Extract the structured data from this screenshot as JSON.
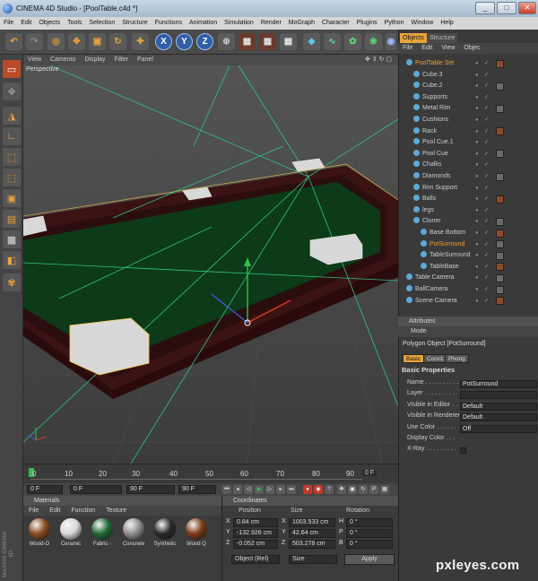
{
  "window": {
    "title": "CINEMA 4D Studio - [PoolTable.c4d *]"
  },
  "menubar": [
    "File",
    "Edit",
    "Objects",
    "Tools",
    "Selection",
    "Structure",
    "Functions",
    "Animation",
    "Simulation",
    "Render",
    "MoGraph",
    "Character",
    "Plugins",
    "Python",
    "Window",
    "Help"
  ],
  "toolbar": {
    "axis_x": "X",
    "axis_y": "Y",
    "axis_z": "Z"
  },
  "viewport": {
    "menu": [
      "View",
      "Cameras",
      "Display",
      "Filter",
      "Panel"
    ],
    "label": "Perspective"
  },
  "timeline": {
    "ticks": [
      "0",
      "10",
      "20",
      "30",
      "40",
      "50",
      "60",
      "70",
      "80",
      "90"
    ],
    "end_label": "0 F",
    "start_field": "0 F",
    "current_field": "0 F",
    "frame_field": "90 F",
    "end_field": "90 F"
  },
  "materials": {
    "header": "Materials",
    "menu": [
      "File",
      "Edit",
      "Function",
      "Texture"
    ],
    "items": [
      {
        "name": "Wood-O",
        "color": "#8a4b1f"
      },
      {
        "name": "Ceramic",
        "color": "#d9d9d9"
      },
      {
        "name": "Fabric -",
        "color": "#1f6a35"
      },
      {
        "name": "Concrete",
        "color": "#8d8d8d"
      },
      {
        "name": "Synthetic",
        "color": "#2a2a2a"
      },
      {
        "name": "Wood Q",
        "color": "#7a3a17"
      }
    ]
  },
  "coordinates": {
    "header": "Coordinates",
    "cols": [
      "Position",
      "Size",
      "Rotation"
    ],
    "rows": [
      {
        "axis": "X",
        "pos": "0.84 cm",
        "size": "1003.533 cm",
        "rlabel": "H",
        "rot": "0 °"
      },
      {
        "axis": "Y",
        "pos": "-132.926 cm",
        "size": "42.64 cm",
        "rlabel": "P",
        "rot": "0 °"
      },
      {
        "axis": "Z",
        "pos": "-0.052 cm",
        "size": "503.278 cm",
        "rlabel": "B",
        "rot": "0 °"
      }
    ],
    "mode": "Object (Rel)",
    "size_mode": "Size",
    "apply": "Apply"
  },
  "objects": {
    "tabs": [
      "Objects",
      "Structure"
    ],
    "menu": [
      "File",
      "Edit",
      "View",
      "Objec"
    ],
    "items": [
      {
        "name": "PoolTable Set",
        "indent": 0,
        "selected": true
      },
      {
        "name": "Cube.3",
        "indent": 1
      },
      {
        "name": "Cube.2",
        "indent": 1
      },
      {
        "name": "Supports",
        "indent": 1
      },
      {
        "name": "Metal Rim",
        "indent": 1
      },
      {
        "name": "Cushions",
        "indent": 1
      },
      {
        "name": "Rack",
        "indent": 1
      },
      {
        "name": "Pool Cue.1",
        "indent": 1
      },
      {
        "name": "Pool Cue",
        "indent": 1
      },
      {
        "name": "Chalks",
        "indent": 1
      },
      {
        "name": "Diamonds",
        "indent": 1
      },
      {
        "name": "Rim Support",
        "indent": 1
      },
      {
        "name": "Balls",
        "indent": 1
      },
      {
        "name": "legs",
        "indent": 1
      },
      {
        "name": "Cloner",
        "indent": 1
      },
      {
        "name": "Base Bottom",
        "indent": 2
      },
      {
        "name": "PotSurround",
        "indent": 2,
        "selected": true
      },
      {
        "name": "TableSurround",
        "indent": 2
      },
      {
        "name": "TableBase",
        "indent": 2
      },
      {
        "name": "Table Camera",
        "indent": 0
      },
      {
        "name": "BallCamera",
        "indent": 0
      },
      {
        "name": "Scene Camera",
        "indent": 0
      }
    ]
  },
  "attributes": {
    "header": "Attributes",
    "mode": "Mode",
    "object_title": "Polygon Object [PotSurround]",
    "tabs": [
      "Basic",
      "Coord.",
      "Phong"
    ],
    "section": "Basic Properties",
    "props": [
      {
        "label": "Name . . . . . . . . . .",
        "value": "PotSurround"
      },
      {
        "label": "Layer . . . . . . . . .",
        "value": ""
      },
      {
        "label": "Visible in Editor . .",
        "value": "Default"
      },
      {
        "label": "Visible in Renderer",
        "value": "Default"
      },
      {
        "label": "Use Color . . . . . .",
        "value": "Off"
      },
      {
        "label": "Display Color . . .",
        "value": ""
      },
      {
        "label": "X-Ray . . . . . . . . .",
        "value": ""
      }
    ]
  },
  "branding": {
    "maxon": "MAXON CINEMA 4D",
    "watermark": "pxleyes.com"
  },
  "colors": {
    "accent": "#f0a030",
    "table_felt": "#0d3a18",
    "table_wood": "#3b1312"
  }
}
